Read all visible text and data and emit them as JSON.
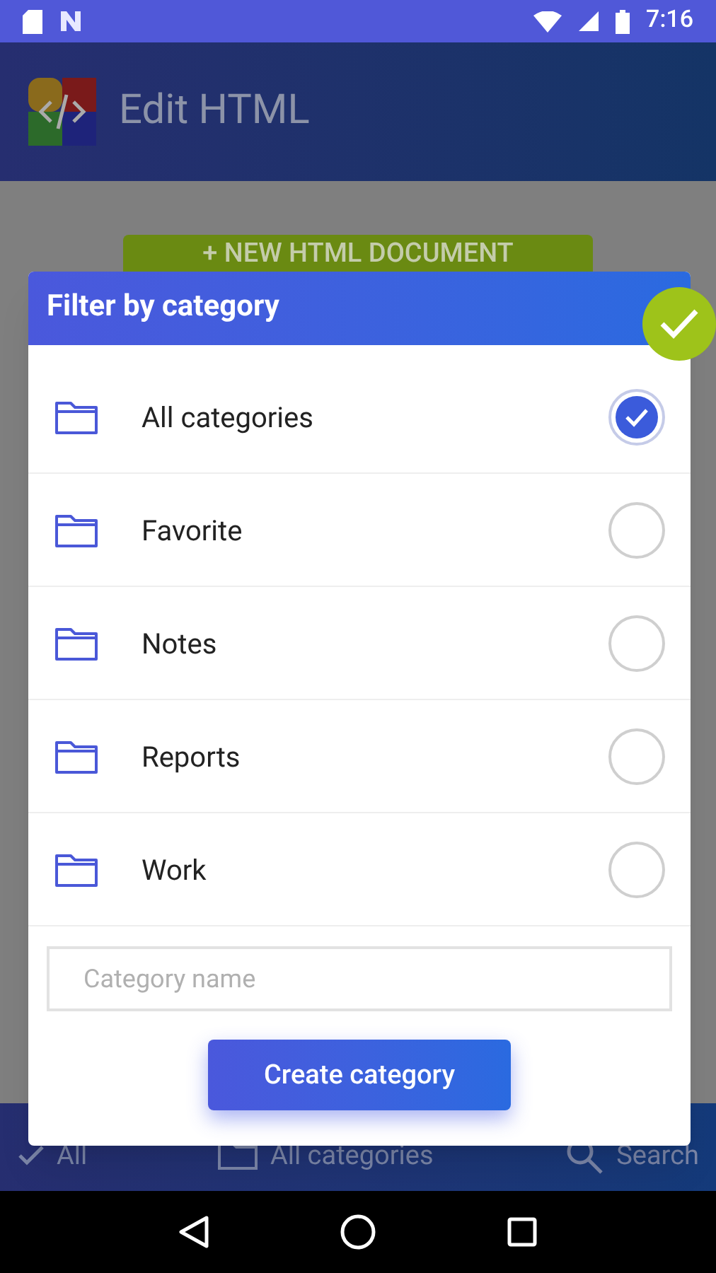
{
  "status_bar": {
    "time": "7:16"
  },
  "app_bar": {
    "title": "Edit HTML"
  },
  "new_document_button": {
    "label": "+ NEW HTML DOCUMENT"
  },
  "bottom_bar": [
    {
      "label": "All",
      "kind": "check"
    },
    {
      "label": "All categories",
      "kind": "folder"
    },
    {
      "label": "Search",
      "kind": "search"
    }
  ],
  "dialog": {
    "title": "Filter by category",
    "categories": [
      {
        "label": "All categories",
        "selected": true
      },
      {
        "label": "Favorite",
        "selected": false
      },
      {
        "label": "Notes",
        "selected": false
      },
      {
        "label": "Reports",
        "selected": false
      },
      {
        "label": "Work",
        "selected": false
      }
    ],
    "name_field": {
      "placeholder": "Category name"
    },
    "create_button": "Create category"
  }
}
